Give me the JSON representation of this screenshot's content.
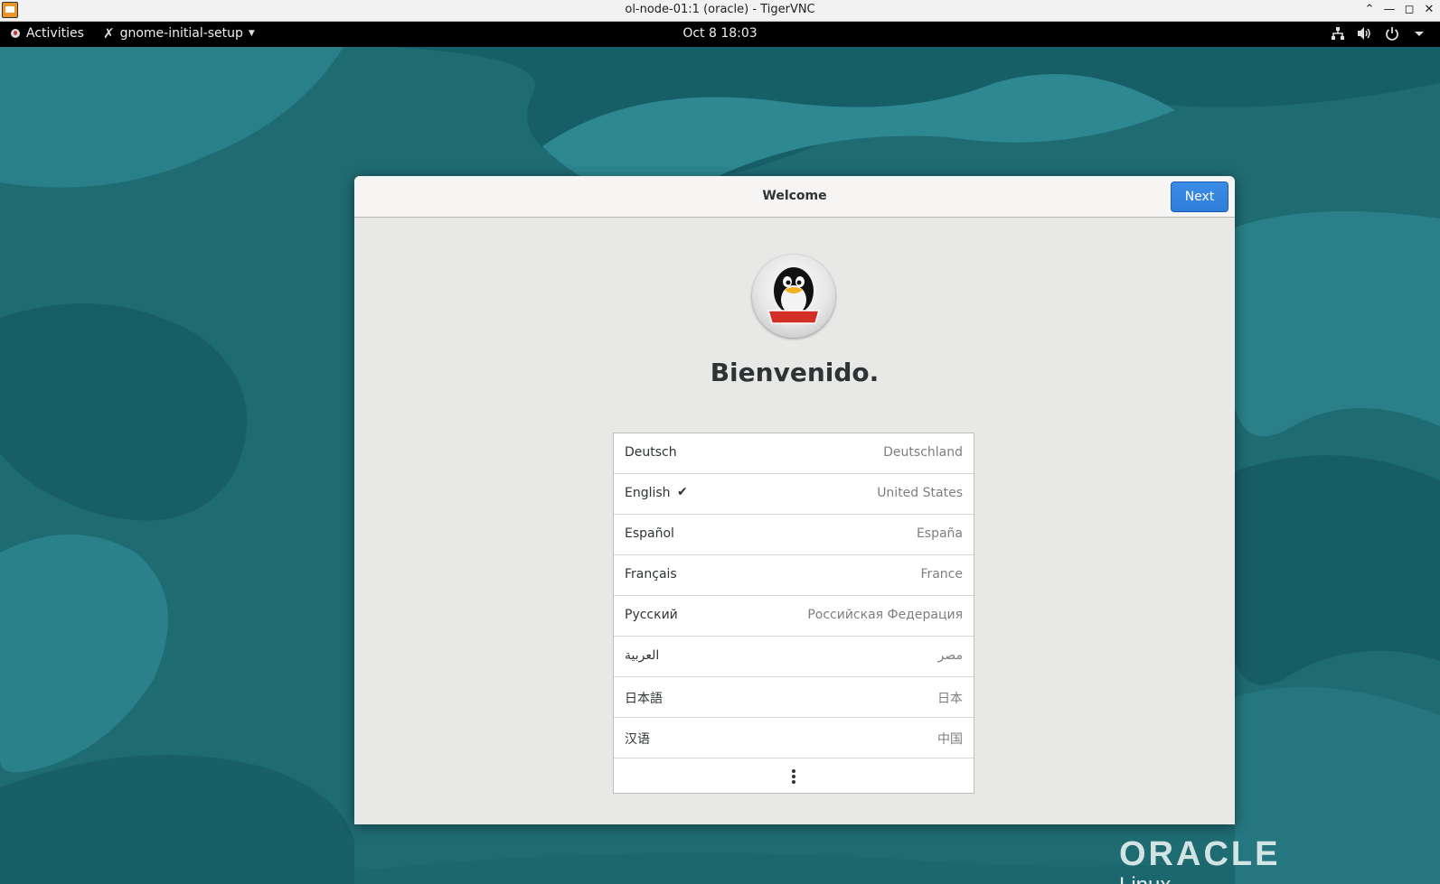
{
  "vnc_window": {
    "title": "ol-node-01:1 (oracle) - TigerVNC",
    "controls": [
      "⌃",
      "—",
      "◻",
      "✕"
    ]
  },
  "topbar": {
    "activities_label": "Activities",
    "app_menu_label": "gnome-initial-setup",
    "clock": "Oct 8  18:03",
    "tray_icons": [
      "network-icon",
      "volume-icon",
      "power-icon",
      "chevron-down-icon"
    ]
  },
  "desktop": {
    "logo_text": "ORACLE",
    "logo_subtext": "Linux"
  },
  "setup": {
    "title": "Welcome",
    "next_label": "Next",
    "heading": "Bienvenido.",
    "languages": [
      {
        "name": "Deutsch",
        "region": "Deutschland",
        "selected": false
      },
      {
        "name": "English",
        "region": "United States",
        "selected": true
      },
      {
        "name": "Español",
        "region": "España",
        "selected": false
      },
      {
        "name": "Français",
        "region": "France",
        "selected": false
      },
      {
        "name": "Русский",
        "region": "Российская Федерация",
        "selected": false
      },
      {
        "name": "العربية",
        "region": "مصر",
        "selected": false
      },
      {
        "name": "日本語",
        "region": "日本",
        "selected": false
      },
      {
        "name": "汉语",
        "region": "中国",
        "selected": false
      }
    ],
    "check_glyph": "✔"
  }
}
